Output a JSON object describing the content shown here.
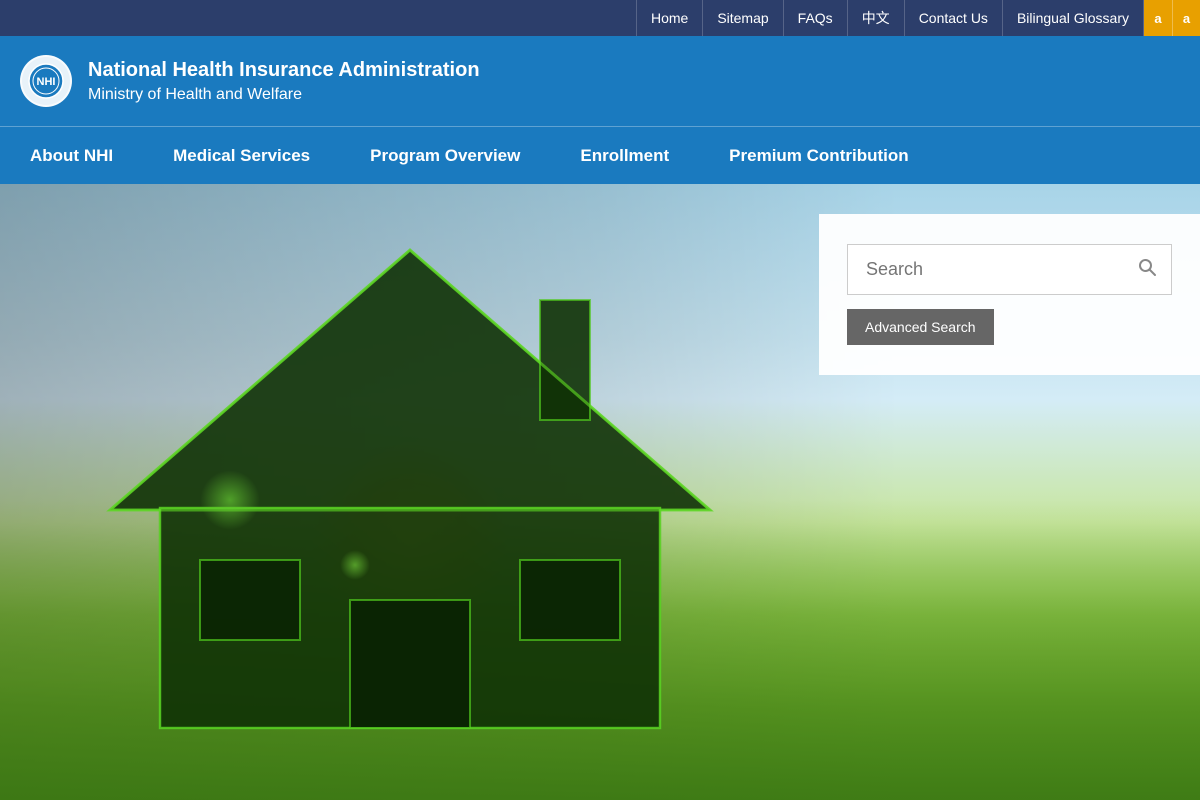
{
  "utilityNav": {
    "items": [
      {
        "label": "Home",
        "href": "#"
      },
      {
        "label": "Sitemap",
        "href": "#"
      },
      {
        "label": "FAQs",
        "href": "#"
      },
      {
        "label": "中文",
        "href": "#"
      },
      {
        "label": "Contact Us",
        "href": "#"
      },
      {
        "label": "Bilingual Glossary",
        "href": "#"
      }
    ],
    "fontBtnA1": "a",
    "fontBtnA2": "a"
  },
  "header": {
    "orgLine1": "National Health Insurance Administration",
    "orgLine2": "Ministry of Health and Welfare"
  },
  "mainNav": {
    "items": [
      {
        "label": "About NHI"
      },
      {
        "label": "Medical Services"
      },
      {
        "label": "Program Overview"
      },
      {
        "label": "Enrollment"
      },
      {
        "label": "Premium Contribution"
      }
    ]
  },
  "search": {
    "placeholder": "Search",
    "advancedLabel": "Advanced Search"
  },
  "colors": {
    "utilityBg": "#2c3e6b",
    "headerBg": "#1a7abf",
    "navBg": "#1a7abf",
    "fontBtnBg": "#e8a000",
    "advancedBtnBg": "#666666"
  }
}
